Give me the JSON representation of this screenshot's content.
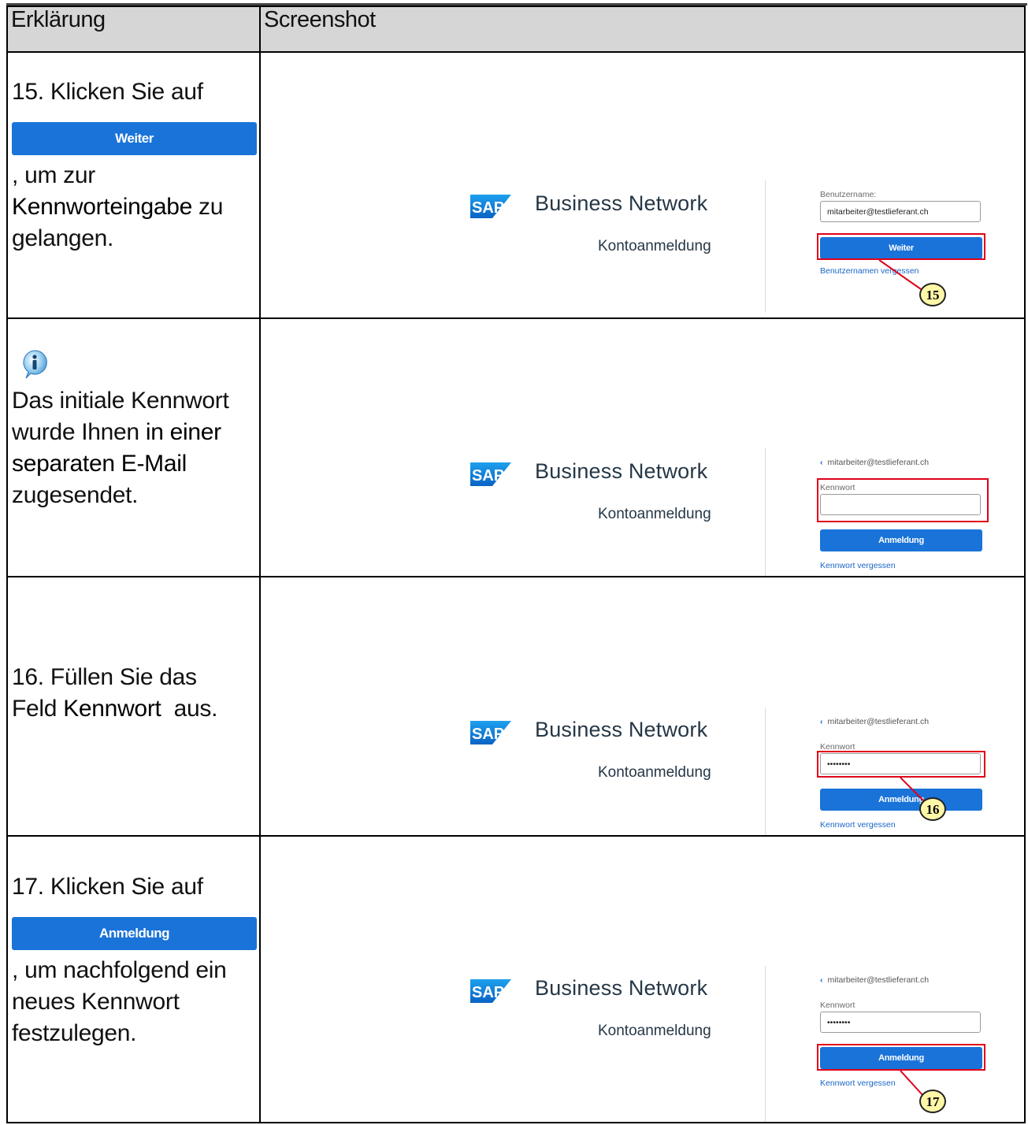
{
  "header": {
    "col1": "Erklärung",
    "col2": "Screenshot"
  },
  "brand": {
    "product": "Business Network",
    "subtitle": "Kontoanmeldung",
    "logo_text": "SAP"
  },
  "steps": [
    {
      "text_prefix": "15. Klicken Sie auf",
      "button_label": "Weiter",
      "text_suffix_1": ", um zur",
      "text_bold": "Kennworteingabe",
      "text_suffix_2": " zu",
      "text_suffix_3": "gelangen.",
      "shot": {
        "username_label": "Benutzername:",
        "username_value": "mitarbeiter@testlieferant.ch",
        "button": "Weiter",
        "link": "Benutzernamen vergessen",
        "callout": "15"
      }
    },
    {
      "info_icon": "info-bubble-icon",
      "text_1": "Das initiale Kennwort",
      "text_2": "wurde Ihnen ",
      "text_bold": "in einer separaten E-Mail",
      "text_3": "zugesendet.",
      "shot": {
        "back_user": "mitarbeiter@testlieferant.ch",
        "password_label": "Kennwort",
        "button": "Anmeldung",
        "link": "Kennwort vergessen"
      }
    },
    {
      "text_1": "16. Füllen Sie das",
      "text_2": "Feld ",
      "text_bold": "Kennwort",
      "text_3": "  aus.",
      "shot": {
        "back_user": "mitarbeiter@testlieferant.ch",
        "password_label": "Kennwort",
        "password_value": "••••••••",
        "button": "Anmeldung",
        "link": "Kennwort vergessen",
        "callout": "16"
      }
    },
    {
      "text_prefix": "17. Klicken Sie auf",
      "button_label": "Anmeldung",
      "text_suffix_1": ", um nachfolgend ein",
      "text_suffix_2": "neues Kennwort",
      "text_suffix_3": "festzulegen.",
      "shot": {
        "back_user": "mitarbeiter@testlieferant.ch",
        "password_label": "Kennwort",
        "password_value": "••••••••",
        "button": "Anmeldung",
        "link": "Kennwort vergessen",
        "callout": "17"
      }
    }
  ],
  "colors": {
    "button_blue": "#1a73d8",
    "highlight_red": "#e0001a",
    "callout_fill": "#fff7a8",
    "header_grey": "#d6d6d6"
  }
}
